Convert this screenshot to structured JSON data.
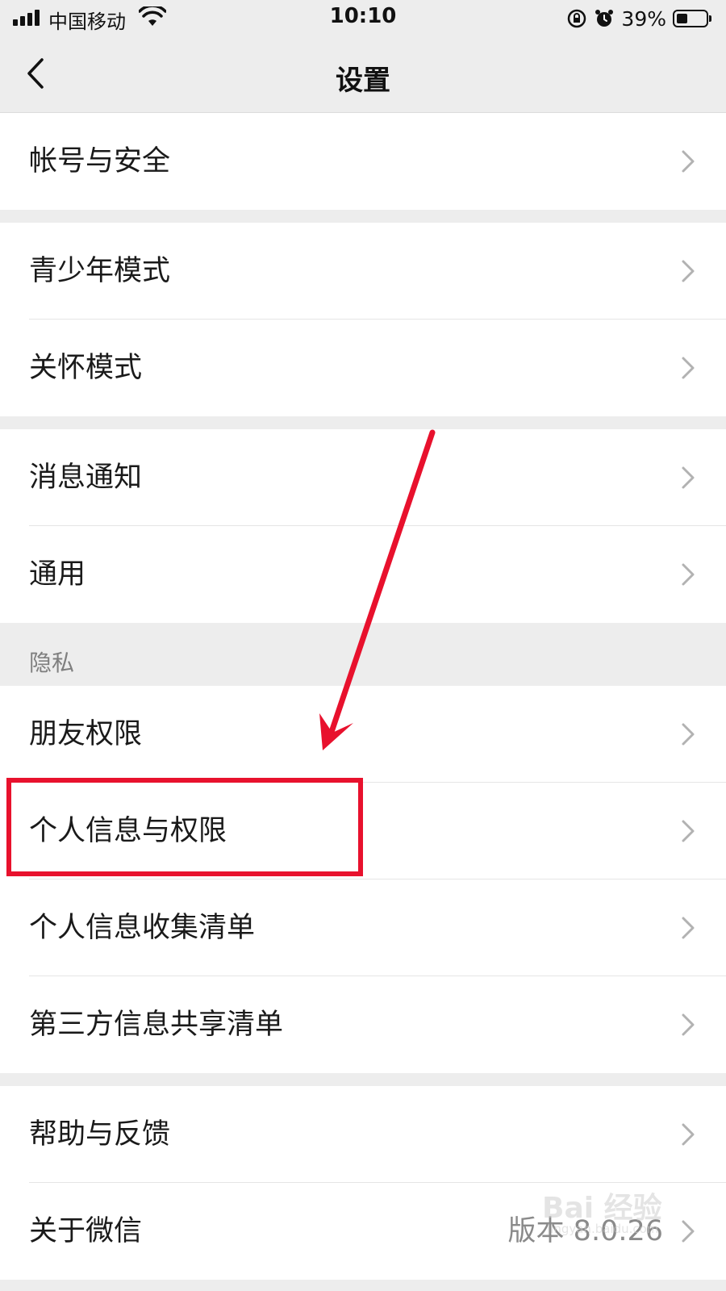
{
  "status_bar": {
    "carrier": "中国移动",
    "time": "10:10",
    "battery_percent": "39%",
    "battery_level": 0.39,
    "icons": [
      "signal-icon",
      "wifi-icon",
      "rotation-lock-icon",
      "alarm-icon",
      "battery-icon"
    ]
  },
  "nav": {
    "title": "设置",
    "back_icon": "chevron-left-icon"
  },
  "settings": {
    "account_security": "帐号与安全",
    "teen_mode": "青少年模式",
    "care_mode": "关怀模式",
    "notifications": "消息通知",
    "general": "通用",
    "privacy_header": "隐私",
    "friend_permissions": "朋友权限",
    "personal_info_permissions": "个人信息与权限",
    "personal_info_collection": "个人信息收集清单",
    "third_party_sharing": "第三方信息共享清单",
    "help_feedback": "帮助与反馈",
    "about_wechat": "关于微信",
    "about_version": "版本 8.0.26"
  },
  "annotation": {
    "highlighted_item": "个人信息与权限",
    "color": "#e8112d"
  },
  "watermark": {
    "text": "Bai 经验",
    "sub": "jingyan.baidu.com"
  },
  "colors": {
    "background": "#ededed",
    "cell": "#ffffff",
    "secondary_text": "#8a8a8a"
  }
}
